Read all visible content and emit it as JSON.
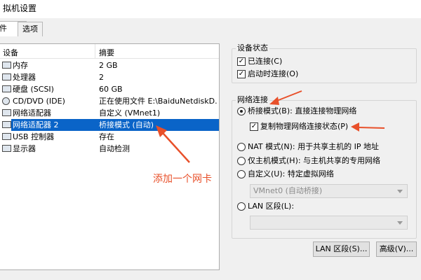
{
  "window": {
    "title": "拟机设置"
  },
  "tabs": [
    {
      "label": "件"
    },
    {
      "label": "选项"
    }
  ],
  "device_list": {
    "columns": [
      "设备",
      "摘要"
    ],
    "rows": [
      {
        "icon": "memory-icon",
        "name": "内存",
        "summary": "2 GB"
      },
      {
        "icon": "cpu-icon",
        "name": "处理器",
        "summary": "2"
      },
      {
        "icon": "hard-disk-icon",
        "name": "硬盘 (SCSI)",
        "summary": "60 GB"
      },
      {
        "icon": "cd-dvd-icon",
        "name": "CD/DVD (IDE)",
        "summary": "正在使用文件 E:\\BaiduNetdiskD..."
      },
      {
        "icon": "network-adapter-icon",
        "name": "网络适配器",
        "summary": "自定义 (VMnet1)"
      },
      {
        "icon": "network-adapter-icon",
        "name": "网络适配器 2",
        "summary": "桥接模式 (自动)",
        "selected": true
      },
      {
        "icon": "usb-icon",
        "name": "USB 控制器",
        "summary": "存在"
      },
      {
        "icon": "display-icon",
        "name": "显示器",
        "summary": "自动检测"
      }
    ]
  },
  "device_status": {
    "title": "设备状态",
    "connected": {
      "label": "已连接(C)",
      "checked": true
    },
    "connect_at_power_on": {
      "label": "启动时连接(O)",
      "checked": true
    }
  },
  "network_connection": {
    "title": "网络连接",
    "bridged": {
      "label": "桥接模式(B): 直接连接物理网络",
      "selected": true
    },
    "replicate": {
      "label": "复制物理网络连接状态(P)",
      "checked": true
    },
    "nat": {
      "label": "NAT 模式(N): 用于共享主机的 IP 地址",
      "selected": false
    },
    "host_only": {
      "label": "仅主机模式(H): 与主机共享的专用网络",
      "selected": false
    },
    "custom": {
      "label": "自定义(U): 特定虚拟网络",
      "selected": false
    },
    "custom_select_value": "VMnet0 (自动桥接)",
    "lan_segment": {
      "label": "LAN 区段(L):",
      "selected": false
    },
    "lan_select_value": ""
  },
  "buttons": {
    "lan_segments": "LAN 区段(S)...",
    "advanced": "高级(V)..."
  },
  "annotation": {
    "text": "添加一个网卡",
    "color": "#e8502a"
  },
  "colors": {
    "selection": "#0a64c8",
    "arrow": "#e8502a"
  }
}
